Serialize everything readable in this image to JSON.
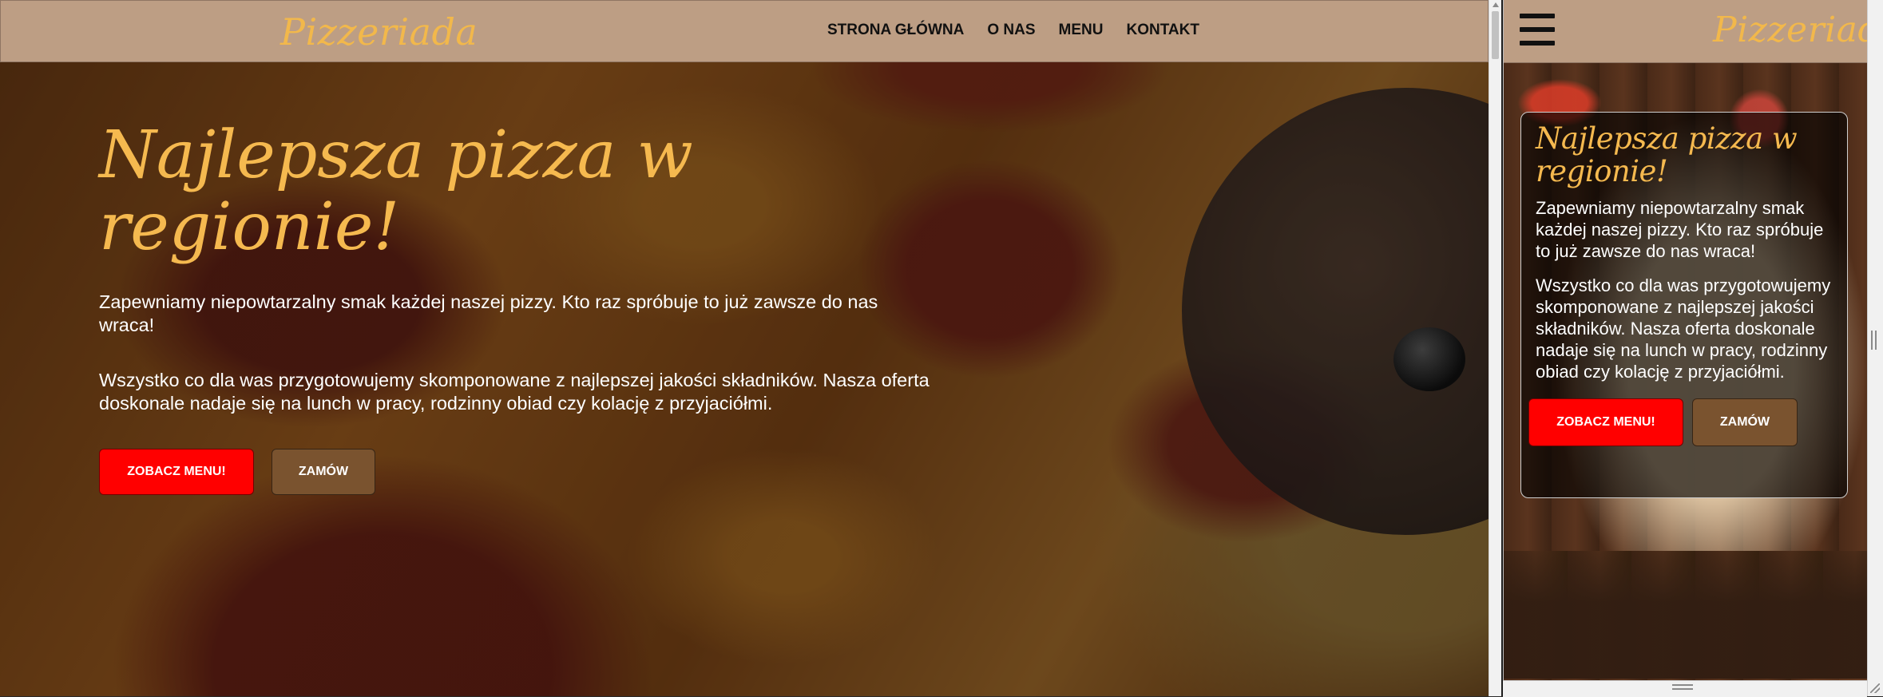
{
  "brand": {
    "logo_text": "Pizzeriada",
    "logo_color": "#f2b84b",
    "navbar_color": "#bd9e84"
  },
  "nav": {
    "items": [
      "STRONA GŁÓWNA",
      "O NAS",
      "MENU",
      "KONTAKT"
    ]
  },
  "hero": {
    "title": "Najlepsza pizza w regionie!",
    "paragraph1": "Zapewniamy niepowtarzalny smak każdej naszej pizzy. Kto raz spróbuje to już zawsze do nas wraca!",
    "paragraph2": "Wszystko co dla was przygotowujemy skomponowane z najlepszej jakości składników. Nasza oferta doskonale nadaje się na lunch w pracy, rodzinny obiad czy kolację z przyjaciółmi.",
    "primary_button": "ZOBACZ MENU!",
    "secondary_button": "ZAMÓW",
    "title_color": "#f5b94f",
    "primary_color": "#ff0000",
    "secondary_color": "#7a532f"
  },
  "mobile": {
    "menu_icon": "hamburger-menu-icon"
  }
}
